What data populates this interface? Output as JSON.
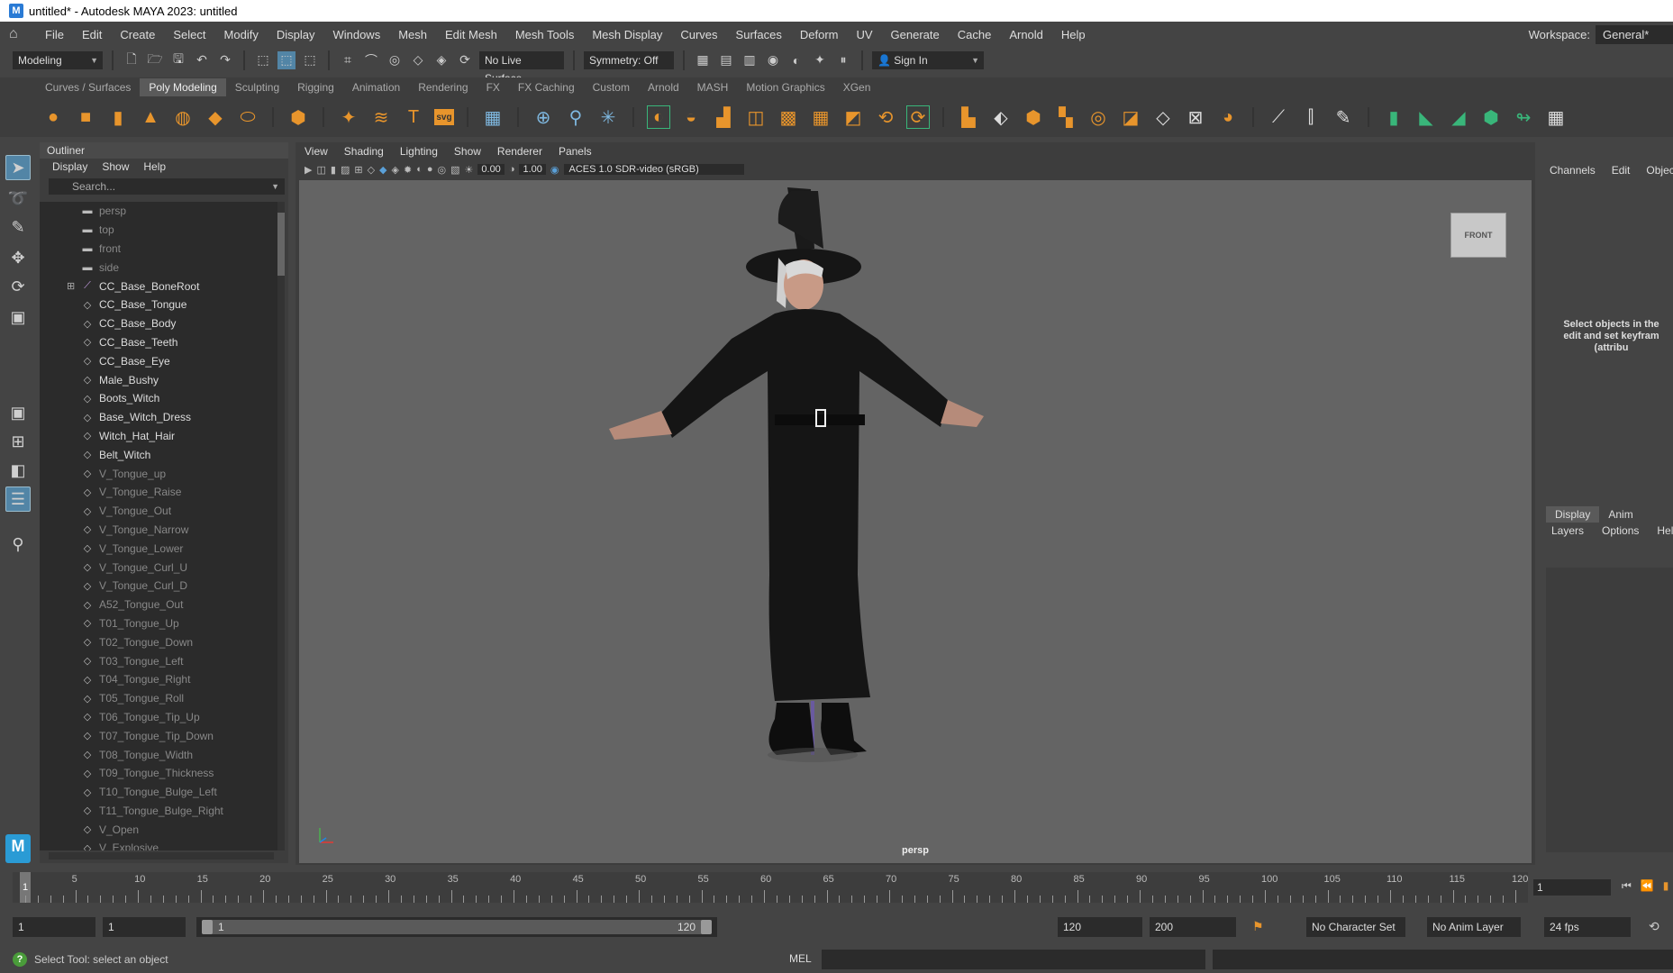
{
  "window": {
    "title": "untitled* - Autodesk MAYA 2023: untitled",
    "app_icon": "M"
  },
  "menubar": {
    "items": [
      "File",
      "Edit",
      "Create",
      "Select",
      "Modify",
      "Display",
      "Windows",
      "Mesh",
      "Edit Mesh",
      "Mesh Tools",
      "Mesh Display",
      "Curves",
      "Surfaces",
      "Deform",
      "UV",
      "Generate",
      "Cache",
      "Arnold",
      "Help"
    ],
    "workspace_label": "Workspace:",
    "workspace_value": "General*"
  },
  "statusline": {
    "mode": "Modeling",
    "live_surface": "No Live Surface",
    "symmetry": "Symmetry: Off",
    "sign_in": "Sign In"
  },
  "shelf": {
    "tabs": [
      "Curves / Surfaces",
      "Poly Modeling",
      "Sculpting",
      "Rigging",
      "Animation",
      "Rendering",
      "FX",
      "FX Caching",
      "Custom",
      "Arnold",
      "MASH",
      "Motion Graphics",
      "XGen"
    ],
    "active_tab": "Poly Modeling",
    "svg_label": "svg"
  },
  "outliner": {
    "title": "Outliner",
    "menu": [
      "Display",
      "Show",
      "Help"
    ],
    "search_placeholder": "Search...",
    "items": [
      {
        "label": "persp",
        "icon": "camera-icon",
        "dim": true
      },
      {
        "label": "top",
        "icon": "camera-icon",
        "dim": true
      },
      {
        "label": "front",
        "icon": "camera-icon",
        "dim": true
      },
      {
        "label": "side",
        "icon": "camera-icon",
        "dim": true
      },
      {
        "label": "CC_Base_BoneRoot",
        "icon": "joint-icon",
        "dim": false,
        "expandable": true
      },
      {
        "label": "CC_Base_Tongue",
        "icon": "mesh-icon",
        "dim": false
      },
      {
        "label": "CC_Base_Body",
        "icon": "mesh-icon",
        "dim": false
      },
      {
        "label": "CC_Base_Teeth",
        "icon": "mesh-icon",
        "dim": false
      },
      {
        "label": "CC_Base_Eye",
        "icon": "mesh-icon",
        "dim": false
      },
      {
        "label": "Male_Bushy",
        "icon": "mesh-icon",
        "dim": false
      },
      {
        "label": "Boots_Witch",
        "icon": "mesh-icon",
        "dim": false
      },
      {
        "label": "Base_Witch_Dress",
        "icon": "mesh-icon",
        "dim": false
      },
      {
        "label": "Witch_Hat_Hair",
        "icon": "mesh-icon",
        "dim": false
      },
      {
        "label": "Belt_Witch",
        "icon": "mesh-icon",
        "dim": false
      },
      {
        "label": "V_Tongue_up",
        "icon": "mesh-icon",
        "dim": true
      },
      {
        "label": "V_Tongue_Raise",
        "icon": "mesh-icon",
        "dim": true
      },
      {
        "label": "V_Tongue_Out",
        "icon": "mesh-icon",
        "dim": true
      },
      {
        "label": "V_Tongue_Narrow",
        "icon": "mesh-icon",
        "dim": true
      },
      {
        "label": "V_Tongue_Lower",
        "icon": "mesh-icon",
        "dim": true
      },
      {
        "label": "V_Tongue_Curl_U",
        "icon": "mesh-icon",
        "dim": true
      },
      {
        "label": "V_Tongue_Curl_D",
        "icon": "mesh-icon",
        "dim": true
      },
      {
        "label": "A52_Tongue_Out",
        "icon": "mesh-icon",
        "dim": true
      },
      {
        "label": "T01_Tongue_Up",
        "icon": "mesh-icon",
        "dim": true
      },
      {
        "label": "T02_Tongue_Down",
        "icon": "mesh-icon",
        "dim": true
      },
      {
        "label": "T03_Tongue_Left",
        "icon": "mesh-icon",
        "dim": true
      },
      {
        "label": "T04_Tongue_Right",
        "icon": "mesh-icon",
        "dim": true
      },
      {
        "label": "T05_Tongue_Roll",
        "icon": "mesh-icon",
        "dim": true
      },
      {
        "label": "T06_Tongue_Tip_Up",
        "icon": "mesh-icon",
        "dim": true
      },
      {
        "label": "T07_Tongue_Tip_Down",
        "icon": "mesh-icon",
        "dim": true
      },
      {
        "label": "T08_Tongue_Width",
        "icon": "mesh-icon",
        "dim": true
      },
      {
        "label": "T09_Tongue_Thickness",
        "icon": "mesh-icon",
        "dim": true
      },
      {
        "label": "T10_Tongue_Bulge_Left",
        "icon": "mesh-icon",
        "dim": true
      },
      {
        "label": "T11_Tongue_Bulge_Right",
        "icon": "mesh-icon",
        "dim": true
      },
      {
        "label": "V_Open",
        "icon": "mesh-icon",
        "dim": true
      },
      {
        "label": "V_Explosive",
        "icon": "mesh-icon",
        "dim": true
      }
    ]
  },
  "viewport": {
    "menu": [
      "View",
      "Shading",
      "Lighting",
      "Show",
      "Renderer",
      "Panels"
    ],
    "exposure": "0.00",
    "gamma": "1.00",
    "colorspace": "ACES 1.0 SDR-video (sRGB)",
    "camera_label": "persp",
    "viewcube_label": "FRONT"
  },
  "channelbox": {
    "menu": [
      "Channels",
      "Edit",
      "Object"
    ],
    "message": "Select objects in the\nedit and set keyfram\n(attribu",
    "layer_tabs": [
      "Display",
      "Anim"
    ],
    "layer_menu": [
      "Layers",
      "Options",
      "Help"
    ]
  },
  "timeline": {
    "start": 1,
    "end": 120,
    "ticks": [
      5,
      10,
      15,
      20,
      25,
      30,
      35,
      40,
      45,
      50,
      55,
      60,
      65,
      70,
      75,
      80,
      85,
      90,
      95,
      100,
      105,
      110,
      115,
      120
    ],
    "current_frame": "1",
    "current_frame_field": "1"
  },
  "range": {
    "start_field": "1",
    "anim_start_field": "1",
    "slider_left": "1",
    "slider_right": "120",
    "end_field": "120",
    "anim_end_field": "200",
    "character_set": "No Character Set",
    "anim_layer": "No Anim Layer",
    "fps": "24 fps"
  },
  "statusbar": {
    "help_text": "Select Tool: select an object",
    "mel_label": "MEL"
  },
  "colors": {
    "accent_blue": "#5285a6",
    "shelf_orange": "#e8952c",
    "shelf_green": "#39b67a",
    "help_green": "#4a9c3a"
  }
}
